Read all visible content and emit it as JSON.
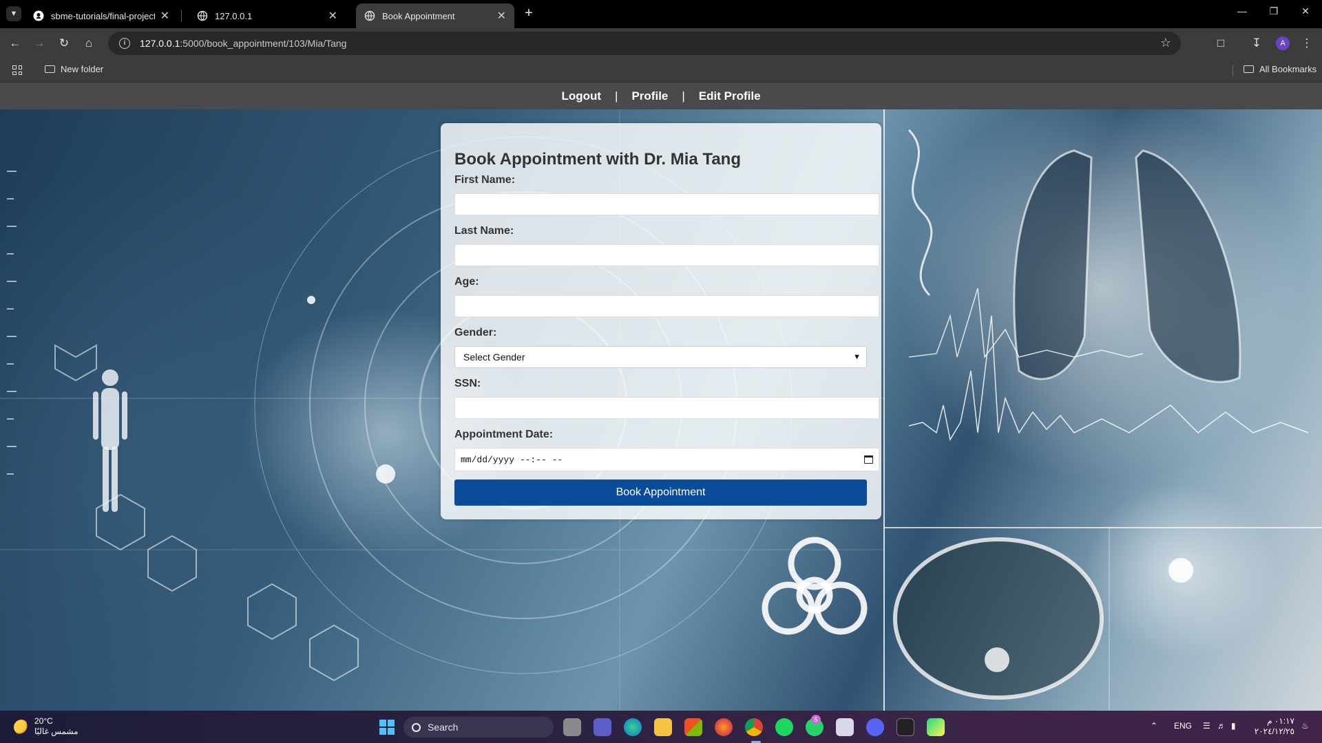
{
  "browser": {
    "tabs": [
      {
        "label": "sbme-tutorials/final-project-da",
        "icon": "github-icon",
        "active": false
      },
      {
        "label": "127.0.0.1",
        "icon": "globe-icon",
        "active": false
      },
      {
        "label": "Book Appointment",
        "icon": "globe-icon",
        "active": true
      }
    ],
    "close_glyph": "✕",
    "new_tab_glyph": "+",
    "url_host": "127.0.0.1",
    "url_rest": ":5000/book_appointment/103/Mia/Tang",
    "profile_initial": "A",
    "bookmarks": {
      "folder": "New folder",
      "all": "All Bookmarks"
    }
  },
  "site_nav": {
    "logout": "Logout",
    "separator": "|",
    "profile": "Profile",
    "edit_profile": "Edit Profile"
  },
  "form": {
    "title": "Book Appointment with Dr. Mia Tang",
    "first_name_label": "First Name:",
    "last_name_label": "Last Name:",
    "age_label": "Age:",
    "gender_label": "Gender:",
    "gender_selected": "Select Gender",
    "ssn_label": "SSN:",
    "date_label": "Appointment Date:",
    "date_placeholder": "mm/dd/yyyy --:-- --",
    "submit_label": "Book Appointment"
  },
  "taskbar": {
    "temperature": "20°C",
    "weather_text": "مشمس غالبًا",
    "search_label": "Search",
    "language": "ENG",
    "time": "٠١:١٧ م",
    "date": "٢٠٢٤/١٢/٢٥",
    "discord_badge": "5"
  },
  "colors": {
    "submit_button": "#0b4c9a",
    "site_nav_bg": "#4a4a4a",
    "active_tab": "#3c3c3c"
  }
}
